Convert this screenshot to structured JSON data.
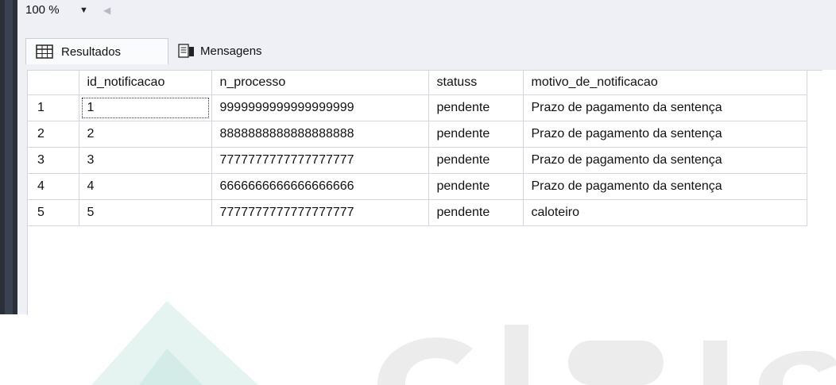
{
  "toolbar": {
    "zoom_value": "100 %"
  },
  "tabs": [
    {
      "label": "Resultados",
      "active": true
    },
    {
      "label": "Mensagens",
      "active": false
    }
  ],
  "grid": {
    "columns": [
      "",
      "id_notificacao",
      "n_processo",
      "statuss",
      "motivo_de_notificacao"
    ],
    "rows": [
      [
        "1",
        "1",
        "9999999999999999999",
        "pendente",
        "Prazo de pagamento da sentença"
      ],
      [
        "2",
        "2",
        "8888888888888888888",
        "pendente",
        "Prazo de pagamento da sentença"
      ],
      [
        "3",
        "3",
        "7777777777777777777",
        "pendente",
        "Prazo de pagamento da sentença"
      ],
      [
        "4",
        "4",
        "6666666666666666666",
        "pendente",
        "Prazo de pagamento da sentença"
      ],
      [
        "5",
        "5",
        "7777777777777777777",
        "pendente",
        "caloteiro"
      ]
    ]
  },
  "colors": {
    "chrome_bg": "#eef0f6",
    "grid_line": "#d3d6de",
    "left_strip": "#2b2f38",
    "watermark_grey": "#e6e6e6",
    "watermark_teal": "#dff1ee"
  },
  "icons": {
    "results_tab": "grid-table-icon",
    "messages_tab": "messages-document-icon",
    "zoom_dropdown": "chevron-down-icon"
  }
}
